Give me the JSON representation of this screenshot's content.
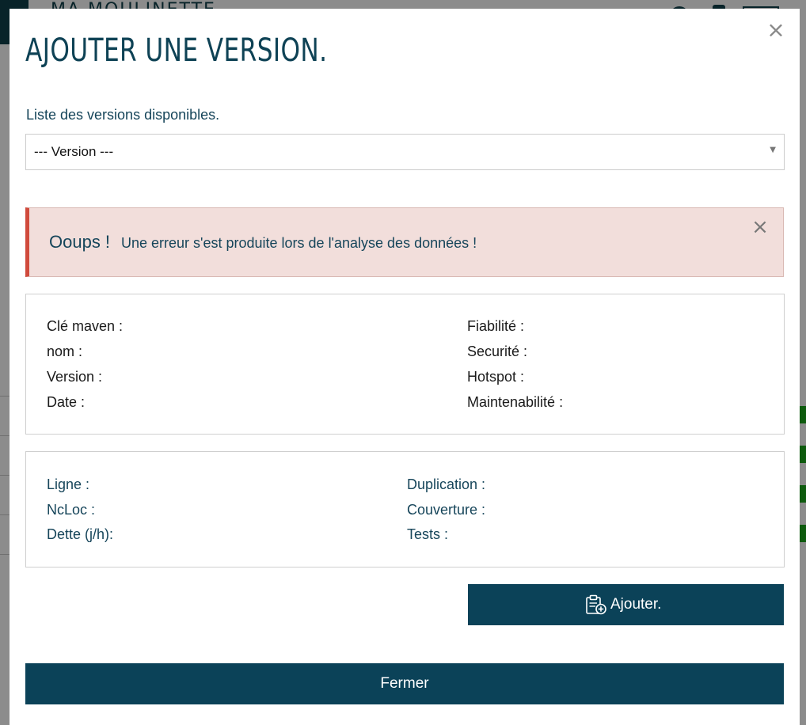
{
  "background": {
    "brand": "MA MOULINETTE"
  },
  "modal": {
    "title": "AJOUTER UNE VERSION.",
    "close_glyph": "×",
    "versions_label": "Liste des versions disponibles.",
    "version_select": {
      "selected": "--- Version ---",
      "arrow": "▼"
    },
    "alert": {
      "strong": "Ooups !",
      "message": "Une erreur s'est produite lors de l'analyse des données !",
      "close_glyph": "×",
      "border_color": "#d04a3c",
      "background_color": "#f2dedb"
    },
    "info": {
      "left": [
        "Clé maven :",
        "nom :",
        "Version :",
        "Date :"
      ],
      "right": [
        "Fiabilité :",
        "Securité :",
        "Hotspot :",
        "Maintenabilité :"
      ]
    },
    "stats": {
      "left": [
        "Ligne :",
        "NcLoc :",
        "Dette (j/h):"
      ],
      "right": [
        "Duplication :",
        "Couverture :",
        "Tests :"
      ]
    },
    "add_button": {
      "icon": "clipboard-add-icon",
      "label": "Ajouter."
    },
    "close_button": {
      "label": "Fermer"
    },
    "colors": {
      "primary": "#0b4258",
      "title": "#0e4255",
      "text": "#16455a"
    }
  }
}
